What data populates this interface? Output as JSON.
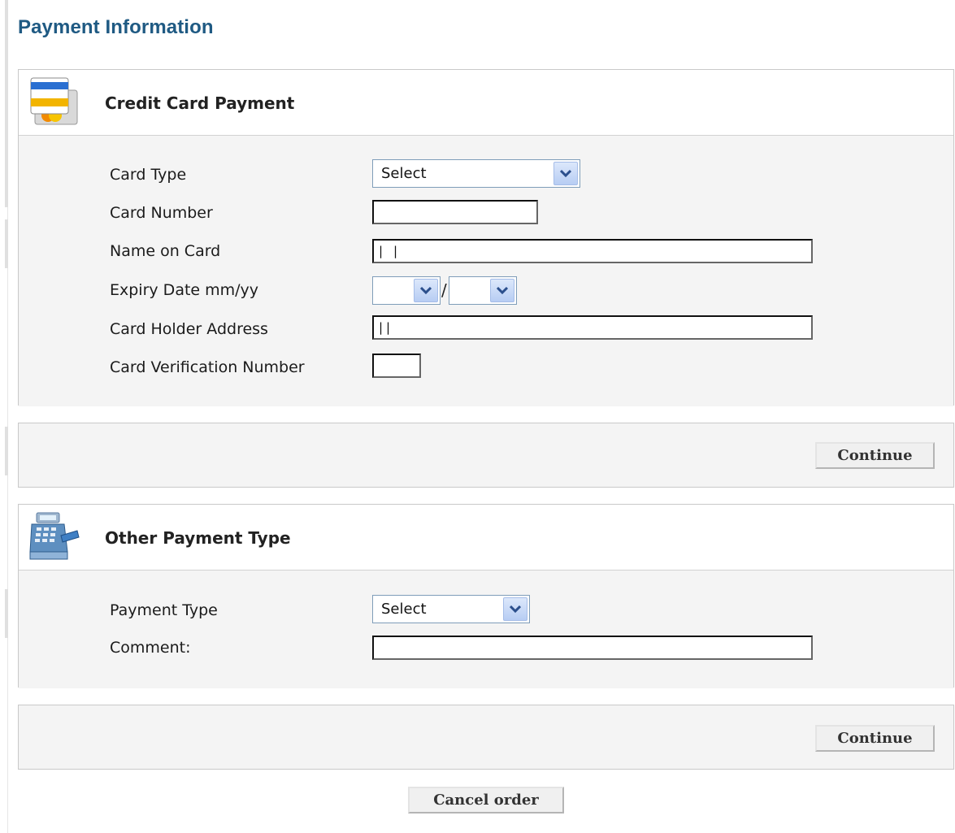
{
  "page": {
    "title": "Payment Information"
  },
  "credit_card": {
    "title": "Credit Card Payment",
    "icon": "credit-card-icon",
    "fields": {
      "card_type": {
        "label": "Card Type",
        "value": "Select"
      },
      "card_number": {
        "label": "Card Number",
        "value": ""
      },
      "name_on_card": {
        "label": "Name on Card",
        "value": "| |"
      },
      "expiry": {
        "label": "Expiry Date mm/yy",
        "separator": "/",
        "month": "",
        "year": ""
      },
      "address": {
        "label": "Card Holder Address",
        "value": "||"
      },
      "cvn": {
        "label": "Card Verification Number",
        "value": ""
      }
    },
    "continue_label": "Continue"
  },
  "other_payment": {
    "title": "Other Payment Type",
    "icon": "cash-register-icon",
    "fields": {
      "payment_type": {
        "label": "Payment Type",
        "value": "Select"
      },
      "comment": {
        "label": "Comment:",
        "value": ""
      }
    },
    "continue_label": "Continue"
  },
  "cancel_label": "Cancel order",
  "colors": {
    "title": "#1f5a83",
    "panel_bg": "#f4f4f4",
    "border": "#c9c9c9",
    "select_border": "#7f9db9"
  }
}
